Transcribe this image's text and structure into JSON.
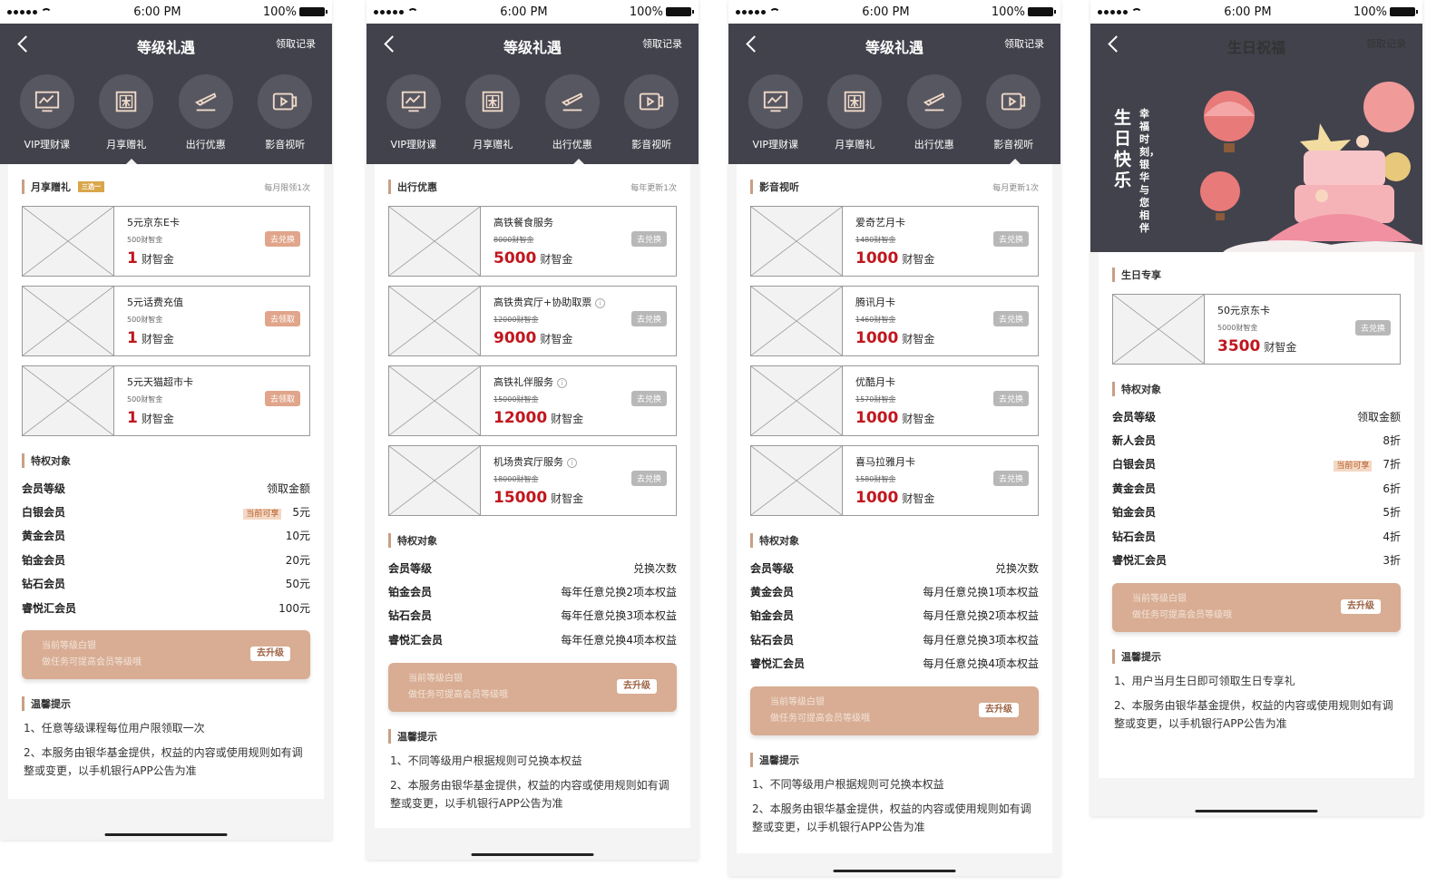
{
  "status": {
    "time": "6:00 PM",
    "battery": "100%"
  },
  "nav": {
    "title": "等级礼遇",
    "birthday_title": "生日祝福",
    "link": "领取记录",
    "categories": [
      {
        "label": "VIP理财课",
        "icon": "chart-screen-icon"
      },
      {
        "label": "月享赠礼",
        "icon": "gift-box-icon"
      },
      {
        "label": "出行优惠",
        "icon": "airplane-ticket-icon"
      },
      {
        "label": "影音视听",
        "icon": "video-play-icon"
      }
    ]
  },
  "common": {
    "privilege_title": "特权对象",
    "member_level": "会员等级",
    "upgrade_line1": "当前等级白银",
    "upgrade_line2": "做任务可提高会员等级哦",
    "upgrade_button": "去升级",
    "tips_title": "温馨提示",
    "current_badge": "当前可享",
    "unit": "财智金",
    "tip_service": "2、本服务由银华基金提供，权益的内容或使用规则如有调整或变更，以手机银行APP公告为准",
    "tip_exchange": "1、不同等级用户根据规则可兑换本权益"
  },
  "screen1": {
    "section_title": "月享赠礼",
    "section_tag": "三选一",
    "section_note": "每月限领1次",
    "items": [
      {
        "name": "5元京东E卡",
        "sub": "500财智金",
        "price": "1",
        "button": "去兑换"
      },
      {
        "name": "5元话费充值",
        "sub": "500财智金",
        "price": "1",
        "button": "去领取"
      },
      {
        "name": "5元天猫超市卡",
        "sub": "500财智金",
        "price": "1",
        "button": "去领取"
      }
    ],
    "privilege_header_right": "领取金额",
    "privileges": [
      {
        "level": "白银会员",
        "value": "5元",
        "current": true
      },
      {
        "level": "黄金会员",
        "value": "10元"
      },
      {
        "level": "铂金会员",
        "value": "20元"
      },
      {
        "level": "钻石会员",
        "value": "50元"
      },
      {
        "level": "睿悦汇会员",
        "value": "100元"
      }
    ],
    "tip1": "1、任意等级课程每位用户限领取一次"
  },
  "screen2": {
    "section_title": "出行优惠",
    "section_note": "每年更新1次",
    "items": [
      {
        "name": "高铁餐食服务",
        "sub": "8000财智金",
        "price": "5000",
        "button": "去兑换"
      },
      {
        "name": "高铁贵宾厅+协助取票",
        "sub": "12000财智金",
        "price": "9000",
        "button": "去兑换"
      },
      {
        "name": "高铁礼伴服务",
        "sub": "15000财智金",
        "price": "12000",
        "button": "去兑换"
      },
      {
        "name": "机场贵宾厅服务",
        "sub": "18000财智金",
        "price": "15000",
        "button": "去兑换"
      }
    ],
    "privilege_header_right": "兑换次数",
    "privileges": [
      {
        "level": "铂金会员",
        "value": "每年任意兑换2项本权益"
      },
      {
        "level": "钻石会员",
        "value": "每年任意兑换3项本权益"
      },
      {
        "level": "睿悦汇会员",
        "value": "每年任意兑换4项本权益"
      }
    ]
  },
  "screen3": {
    "section_title": "影音视听",
    "section_note": "每月更新1次",
    "items": [
      {
        "name": "爱奇艺月卡",
        "sub": "1480财智金",
        "price": "1000",
        "button": "去兑换"
      },
      {
        "name": "腾讯月卡",
        "sub": "1460财智金",
        "price": "1000",
        "button": "去兑换"
      },
      {
        "name": "优酷月卡",
        "sub": "1570财智金",
        "price": "1000",
        "button": "去兑换"
      },
      {
        "name": "喜马拉雅月卡",
        "sub": "1580财智金",
        "price": "1000",
        "button": "去兑换"
      }
    ],
    "privilege_header_right": "兑换次数",
    "privileges": [
      {
        "level": "黄金会员",
        "value": "每月任意兑换1项本权益"
      },
      {
        "level": "铂金会员",
        "value": "每月任意兑换2项本权益"
      },
      {
        "level": "钻石会员",
        "value": "每月任意兑换3项本权益"
      },
      {
        "level": "睿悦汇会员",
        "value": "每月任意兑换4项本权益"
      }
    ]
  },
  "screen4": {
    "banner_big": "生日快乐",
    "banner_small": "幸福时刻，银华与您相伴",
    "section_title": "生日专享",
    "item": {
      "name": "50元京东卡",
      "sub": "5000财智金",
      "price": "3500",
      "button": "去兑换"
    },
    "privilege_header_right": "领取金额",
    "privileges": [
      {
        "level": "新人会员",
        "value": "8折"
      },
      {
        "level": "白银会员",
        "value": "7折",
        "current": true
      },
      {
        "level": "黄金会员",
        "value": "6折"
      },
      {
        "level": "铂金会员",
        "value": "5折"
      },
      {
        "level": "钻石会员",
        "value": "4折"
      },
      {
        "level": "睿悦汇会员",
        "value": "3折"
      }
    ],
    "tip1": "1、用户当月生日即可领取生日专享礼"
  },
  "colors": {
    "nav_bg": "#42424c",
    "accent": "#c8a085",
    "price_red": "#c0171e",
    "button_tan": "#d8ad93"
  }
}
